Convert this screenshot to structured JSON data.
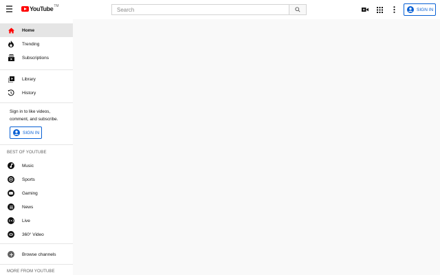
{
  "header": {
    "logo_text": "YouTube",
    "logo_sup": "TM",
    "search_placeholder": "Search",
    "signin_label": "SIGN IN",
    "icons": [
      "menu-icon",
      "search-icon",
      "video-camera-icon",
      "apps-grid-icon",
      "more-vert-icon",
      "account-circle-icon"
    ]
  },
  "sidebar": {
    "primary": [
      {
        "label": "Home",
        "icon": "home-icon",
        "active": true
      },
      {
        "label": "Trending",
        "icon": "flame-icon"
      },
      {
        "label": "Subscriptions",
        "icon": "subscriptions-icon"
      }
    ],
    "secondary": [
      {
        "label": "Library",
        "icon": "library-icon"
      },
      {
        "label": "History",
        "icon": "history-icon"
      }
    ],
    "signin_prompt": "Sign in to like videos, comment, and subscribe.",
    "signin_label": "SIGN IN",
    "best_title": "BEST OF YOUTUBE",
    "best": [
      {
        "label": "Music",
        "icon": "music-icon"
      },
      {
        "label": "Sports",
        "icon": "sports-icon"
      },
      {
        "label": "Gaming",
        "icon": "gaming-icon"
      },
      {
        "label": "News",
        "icon": "news-icon"
      },
      {
        "label": "Live",
        "icon": "live-icon"
      },
      {
        "label": "360° Video",
        "icon": "360-video-icon"
      }
    ],
    "browse_channels": "Browse channels",
    "more_title": "MORE FROM YOUTUBE"
  },
  "colors": {
    "brand_red": "#ff0000",
    "link_blue": "#065fd4",
    "active_bg": "#e5e5e5"
  }
}
